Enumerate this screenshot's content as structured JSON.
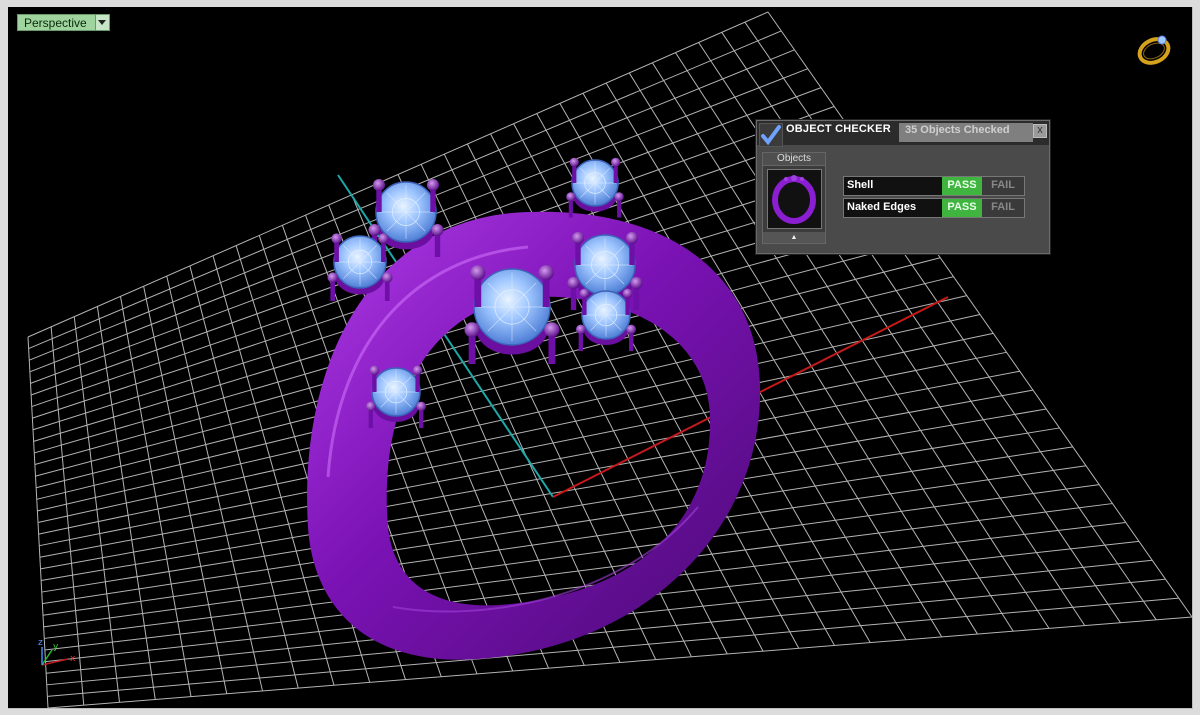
{
  "viewport": {
    "name": "Perspective"
  },
  "object_checker": {
    "title": "OBJECT CHECKER",
    "count_text": "35  Objects Checked",
    "close": "x",
    "objects_label": "Objects",
    "tests": [
      {
        "name": "Shell",
        "pass": "PASS",
        "fail": "FAIL",
        "state": "pass"
      },
      {
        "name": "Naked Edges",
        "pass": "PASS",
        "fail": "FAIL",
        "state": "pass"
      }
    ]
  },
  "axes": {
    "x": "x",
    "y": "y",
    "z": "z"
  },
  "colors": {
    "grid": "#c8c8c8",
    "ring": "#7a12b4",
    "gem": "#9fc6ff",
    "x_axis": "#c41a1a",
    "y_axis": "#1fa8a8",
    "pass": "#3fb43f"
  }
}
